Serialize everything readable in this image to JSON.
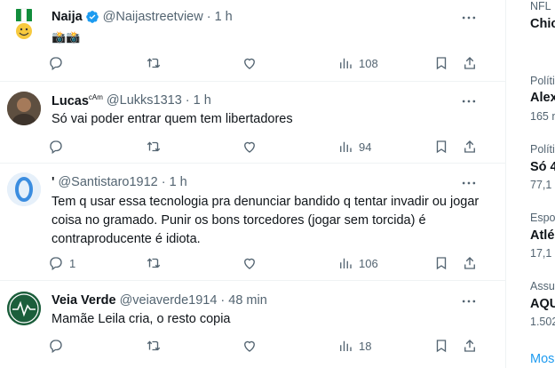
{
  "tweets": [
    {
      "name": "Naija",
      "handle": "@Naijastreetview",
      "time": "1 h",
      "text": "📸📸",
      "reply_count": "",
      "retweet_count": "",
      "like_count": "",
      "views": "108"
    },
    {
      "name": "Lucas",
      "name_sup": "cAm",
      "handle": "@Lukks1313",
      "time": "1 h",
      "text": "Só vai poder entrar quem tem libertadores",
      "views": "94"
    },
    {
      "name": "'",
      "handle": "@Santistaro1912",
      "time": "1 h",
      "text": "Tem q usar essa tecnologia pra denunciar bandido q tentar invadir ou jogar coisa no gramado. Punir os bons torcedores (jogar sem torcida) é contraproducente é idiota.",
      "reply_count": "1",
      "views": "106"
    },
    {
      "name": "Veia Verde",
      "handle": "@veiaverde1914",
      "time": "48 min",
      "text": "Mamãe Leila cria, o resto copia",
      "views": "18"
    }
  ],
  "sidebar": {
    "items": [
      {
        "category": "NFL",
        "title": "Chic"
      },
      {
        "category": "Políti",
        "title": "Alex",
        "count": "165 n"
      },
      {
        "category": "Políti",
        "title": "Só 4",
        "count": "77,1"
      },
      {
        "category": "Espo",
        "title": "Atlé",
        "count": "17,1"
      },
      {
        "category": "Assu",
        "title": "AQU",
        "count": "1.502"
      }
    ],
    "show_more": "Mos"
  },
  "colors": {
    "accent": "#1d9bf0",
    "secondary_text": "#536471",
    "primary_text": "#0f1419",
    "divider": "#eff3f4"
  }
}
